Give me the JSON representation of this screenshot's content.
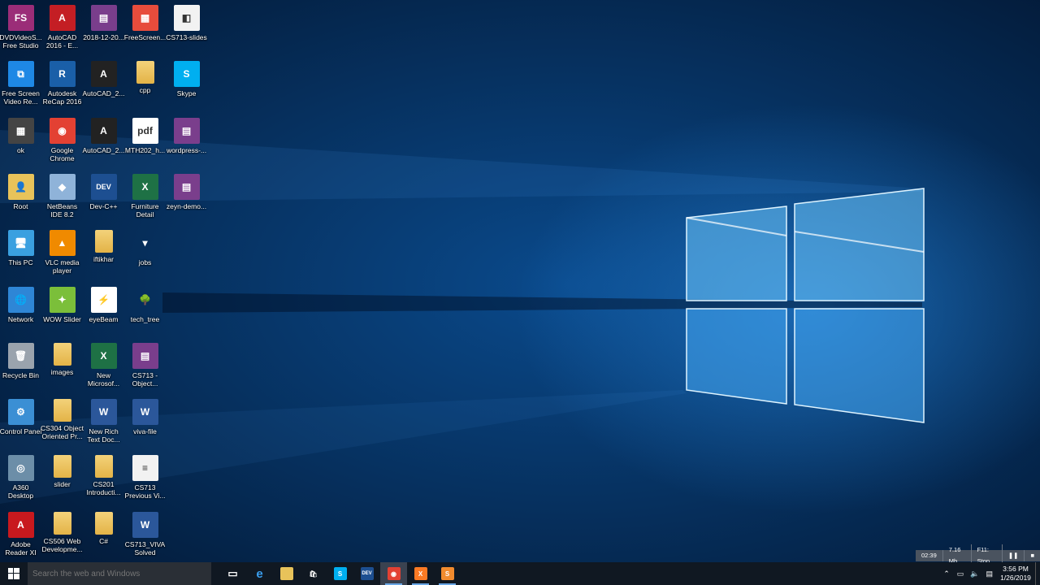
{
  "desktop_icons": [
    {
      "label": "DVDVideoS... Free Studio",
      "icon": "fs-app-icon",
      "col": 0,
      "row": 0,
      "color": "#9b2d78",
      "glyph": "FS"
    },
    {
      "label": "Free Screen Video Re...",
      "icon": "screen-recorder-icon",
      "col": 0,
      "row": 1,
      "color": "#1e88e5",
      "glyph": "⧉"
    },
    {
      "label": "ok",
      "icon": "video-file-icon",
      "col": 0,
      "row": 2,
      "color": "#444444",
      "glyph": "▦"
    },
    {
      "label": "Root",
      "icon": "user-folder-icon",
      "col": 0,
      "row": 3,
      "color": "#e8c35a",
      "glyph": "👤"
    },
    {
      "label": "This PC",
      "icon": "this-pc-icon",
      "col": 0,
      "row": 4,
      "color": "#3aa0e0",
      "glyph": "🖥"
    },
    {
      "label": "Network",
      "icon": "network-icon",
      "col": 0,
      "row": 5,
      "color": "#2e86d6",
      "glyph": "🌐"
    },
    {
      "label": "Recycle Bin",
      "icon": "recycle-bin-icon",
      "col": 0,
      "row": 6,
      "color": "#9aa3ad",
      "glyph": "🗑"
    },
    {
      "label": "Control Panel",
      "icon": "control-panel-icon",
      "col": 0,
      "row": 7,
      "color": "#3b8fd4",
      "glyph": "⚙"
    },
    {
      "label": "A360 Desktop",
      "icon": "a360-icon",
      "col": 0,
      "row": 8,
      "color": "#6c8ea8",
      "glyph": "◎"
    },
    {
      "label": "Adobe Reader XI",
      "icon": "adobe-reader-icon",
      "col": 0,
      "row": 9,
      "color": "#c8191e",
      "glyph": "A"
    },
    {
      "label": "AutoCAD 2016 - E...",
      "icon": "autocad-icon",
      "col": 1,
      "row": 0,
      "color": "#c41e24",
      "glyph": "A"
    },
    {
      "label": "Autodesk ReCap 2016",
      "icon": "recap-icon",
      "col": 1,
      "row": 1,
      "color": "#1a5fa8",
      "glyph": "R"
    },
    {
      "label": "Google Chrome",
      "icon": "chrome-icon",
      "col": 1,
      "row": 2,
      "color": "#e34133",
      "glyph": "◉"
    },
    {
      "label": "NetBeans IDE 8.2",
      "icon": "netbeans-icon",
      "col": 1,
      "row": 3,
      "color": "#8fb3d9",
      "glyph": "◆"
    },
    {
      "label": "VLC media player",
      "icon": "vlc-icon",
      "col": 1,
      "row": 4,
      "color": "#f08a00",
      "glyph": "▲"
    },
    {
      "label": "WOW Slider",
      "icon": "wow-slider-icon",
      "col": 1,
      "row": 5,
      "color": "#7bbf3a",
      "glyph": "✦"
    },
    {
      "label": "images",
      "icon": "folder-icon",
      "col": 1,
      "row": 6,
      "color": "#e8c35a",
      "glyph": ""
    },
    {
      "label": "CS304 Object Oriented Pr...",
      "icon": "folder-icon",
      "col": 1,
      "row": 7,
      "color": "#e8c35a",
      "glyph": ""
    },
    {
      "label": "slider",
      "icon": "folder-icon",
      "col": 1,
      "row": 8,
      "color": "#e8c35a",
      "glyph": ""
    },
    {
      "label": "CS506 Web Developme...",
      "icon": "folder-icon",
      "col": 1,
      "row": 9,
      "color": "#e8c35a",
      "glyph": ""
    },
    {
      "label": "2018-12-20...",
      "icon": "winrar-archive-icon",
      "col": 2,
      "row": 0,
      "color": "#7a3e8c",
      "glyph": "▤"
    },
    {
      "label": "AutoCAD_2...",
      "icon": "autocad-installer-icon",
      "col": 2,
      "row": 1,
      "color": "#222222",
      "glyph": "A"
    },
    {
      "label": "AutoCAD_2...",
      "icon": "autocad-installer-icon",
      "col": 2,
      "row": 2,
      "color": "#222222",
      "glyph": "A"
    },
    {
      "label": "Dev-C++",
      "icon": "dev-cpp-icon",
      "col": 2,
      "row": 3,
      "color": "#1d4f91",
      "glyph": "DEV"
    },
    {
      "label": "iftikhar",
      "icon": "folder-icon",
      "col": 2,
      "row": 4,
      "color": "#e8c35a",
      "glyph": ""
    },
    {
      "label": "eyeBeam",
      "icon": "eyebeam-icon",
      "col": 2,
      "row": 5,
      "color": "#ffffff",
      "glyph": "⚡"
    },
    {
      "label": "New Microsof...",
      "icon": "excel-file-icon",
      "col": 2,
      "row": 6,
      "color": "#1e7145",
      "glyph": "X"
    },
    {
      "label": "New Rich Text Doc...",
      "icon": "word-file-icon",
      "col": 2,
      "row": 7,
      "color": "#2b579a",
      "glyph": "W"
    },
    {
      "label": "CS201 Introducti...",
      "icon": "folder-icon",
      "col": 2,
      "row": 8,
      "color": "#e8c35a",
      "glyph": ""
    },
    {
      "label": "C#",
      "icon": "folder-icon",
      "col": 2,
      "row": 9,
      "color": "#e8c35a",
      "glyph": ""
    },
    {
      "label": "FreeScreen...",
      "icon": "freescreen-icon",
      "col": 3,
      "row": 0,
      "color": "#e74c3c",
      "glyph": "▦"
    },
    {
      "label": "cpp",
      "icon": "folder-icon",
      "col": 3,
      "row": 1,
      "color": "#e8c35a",
      "glyph": ""
    },
    {
      "label": "MTH202_h...",
      "icon": "pdf-file-icon",
      "col": 3,
      "row": 2,
      "color": "#ffffff",
      "glyph": "pdf"
    },
    {
      "label": "Furniture Detail",
      "icon": "excel-file-icon",
      "col": 3,
      "row": 3,
      "color": "#1e7145",
      "glyph": "X"
    },
    {
      "label": "jobs",
      "icon": "small-file-icon",
      "col": 3,
      "row": 4,
      "color": "transparent",
      "glyph": "▾"
    },
    {
      "label": "tech_tree",
      "icon": "tree-icon",
      "col": 3,
      "row": 5,
      "color": "transparent",
      "glyph": "🌳"
    },
    {
      "label": "CS713 - Object...",
      "icon": "winrar-archive-icon",
      "col": 3,
      "row": 6,
      "color": "#7a3e8c",
      "glyph": "▤"
    },
    {
      "label": "viva-file",
      "icon": "word-file-icon",
      "col": 3,
      "row": 7,
      "color": "#2b579a",
      "glyph": "W"
    },
    {
      "label": "CS713 Previous Vi...",
      "icon": "text-file-icon",
      "col": 3,
      "row": 8,
      "color": "#f2f2f2",
      "glyph": "≡"
    },
    {
      "label": "CS713_VIVA Solved",
      "icon": "word-file-icon",
      "col": 3,
      "row": 9,
      "color": "#2b579a",
      "glyph": "W"
    },
    {
      "label": "CS713-slides",
      "icon": "visual-studio-file-icon",
      "col": 4,
      "row": 0,
      "color": "#f2f2f2",
      "glyph": "◧"
    },
    {
      "label": "Skype",
      "icon": "skype-icon",
      "col": 4,
      "row": 1,
      "color": "#00aff0",
      "glyph": "S"
    },
    {
      "label": "wordpress-...",
      "icon": "winrar-archive-icon",
      "col": 4,
      "row": 2,
      "color": "#7a3e8c",
      "glyph": "▤"
    },
    {
      "label": "zeyn-demo...",
      "icon": "winrar-archive-icon",
      "col": 4,
      "row": 3,
      "color": "#7a3e8c",
      "glyph": "▤"
    }
  ],
  "taskbar": {
    "search_placeholder": "Search the web and Windows",
    "apps": [
      {
        "name": "task-view",
        "icon": "task-view-icon",
        "color": "transparent",
        "glyph": "▭",
        "state": ""
      },
      {
        "name": "edge",
        "icon": "edge-icon",
        "color": "transparent",
        "glyph": "e",
        "state": ""
      },
      {
        "name": "file-explorer",
        "icon": "file-explorer-icon",
        "color": "#e8c35a",
        "glyph": "",
        "state": ""
      },
      {
        "name": "store",
        "icon": "store-icon",
        "color": "transparent",
        "glyph": "🛍",
        "state": ""
      },
      {
        "name": "skype",
        "icon": "skype-icon",
        "color": "#00aff0",
        "glyph": "S",
        "state": ""
      },
      {
        "name": "dev-cpp",
        "icon": "dev-cpp-icon",
        "color": "#1d4f91",
        "glyph": "DEV",
        "state": ""
      },
      {
        "name": "chrome",
        "icon": "chrome-icon",
        "color": "#e34133",
        "glyph": "◉",
        "state": "active"
      },
      {
        "name": "xampp",
        "icon": "xampp-icon",
        "color": "#fb7a24",
        "glyph": "X",
        "state": "open"
      },
      {
        "name": "sublime",
        "icon": "sublime-text-icon",
        "color": "#f28b2e",
        "glyph": "S",
        "state": "open"
      }
    ],
    "clock_time": "3:56 PM",
    "clock_date": "1/26/2019"
  },
  "recorder": {
    "elapsed": "02:39",
    "size": "7.16 Mb",
    "stop_hint": "F11: Stop"
  }
}
